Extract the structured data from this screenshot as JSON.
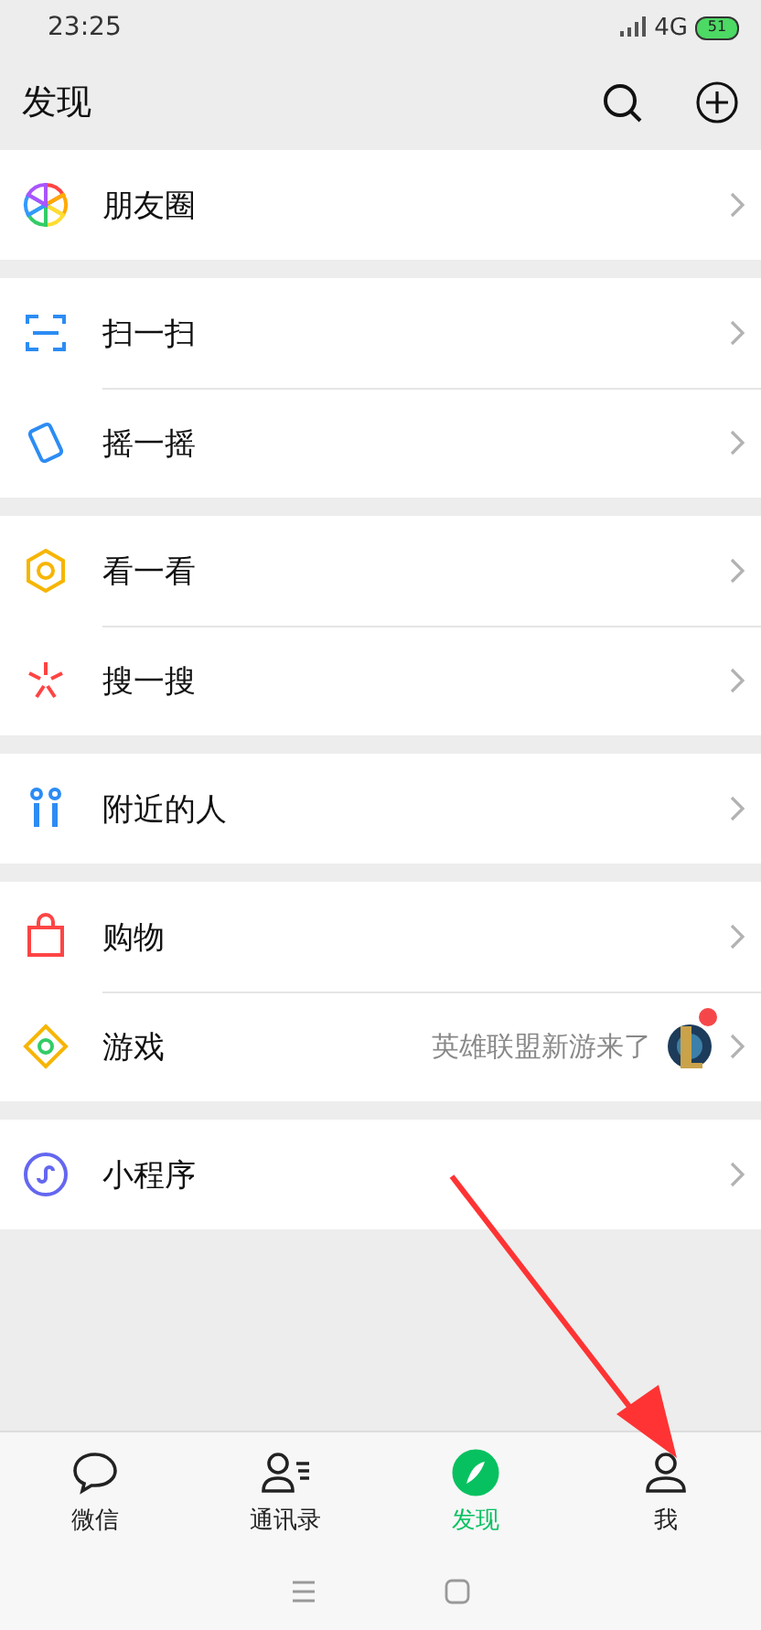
{
  "status_bar": {
    "time": "23:25",
    "network": "4G",
    "battery": "51"
  },
  "header": {
    "title": "发现"
  },
  "groups": [
    {
      "items": [
        {
          "label": "朋友圈"
        }
      ]
    },
    {
      "items": [
        {
          "label": "扫一扫"
        },
        {
          "label": "摇一摇"
        }
      ]
    },
    {
      "items": [
        {
          "label": "看一看"
        },
        {
          "label": "搜一搜"
        }
      ]
    },
    {
      "items": [
        {
          "label": "附近的人"
        }
      ]
    },
    {
      "items": [
        {
          "label": "购物"
        },
        {
          "label": "游戏",
          "note": "英雄联盟新游来了",
          "thumbnail": true,
          "unread": true
        }
      ]
    },
    {
      "items": [
        {
          "label": "小程序"
        }
      ]
    }
  ],
  "tabs": [
    {
      "label": "微信",
      "selected": false
    },
    {
      "label": "通讯录",
      "selected": false
    },
    {
      "label": "发现",
      "selected": true
    },
    {
      "label": "我",
      "selected": false
    }
  ]
}
